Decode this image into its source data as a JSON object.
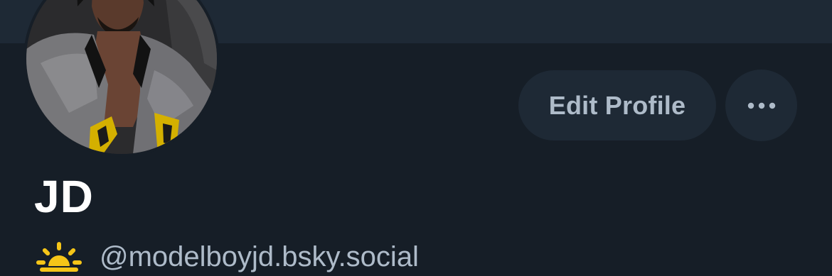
{
  "profile": {
    "display_name": "JD",
    "handle": "@modelboyjd.bsky.social",
    "handle_prefix_icon": "sunrise-emoji-icon"
  },
  "actions": {
    "edit_profile_label": "Edit Profile",
    "more_icon": "ellipsis-icon"
  },
  "colors": {
    "background": "#161e27",
    "banner": "#1e2935",
    "button_bg": "#1e2935",
    "button_text": "#aebbc9",
    "name_text": "#ffffff",
    "handle_text": "#aebbc9",
    "sun_yellow": "#f5c518"
  }
}
